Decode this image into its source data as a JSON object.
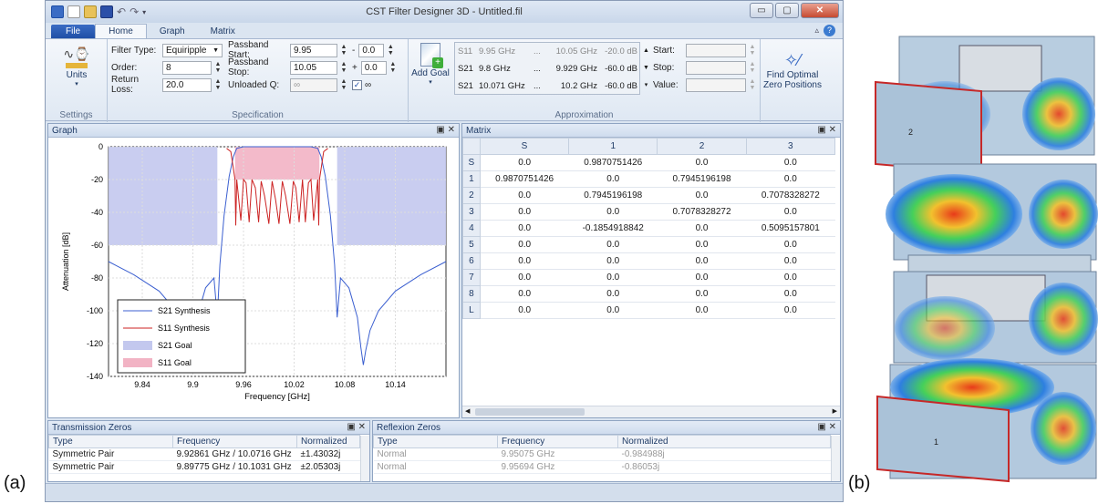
{
  "labels": {
    "a": "(a)",
    "b": "(b)"
  },
  "window": {
    "title": "CST Filter Designer 3D - Untitled.fil",
    "controls": [
      "▭",
      "▢",
      "✕"
    ]
  },
  "ribbon_tabs": {
    "file": "File",
    "home": "Home",
    "graph": "Graph",
    "matrix": "Matrix"
  },
  "settings": {
    "units_label": "Units",
    "group_label": "Settings"
  },
  "spec": {
    "group_label": "Specification",
    "filter_type_label": "Filter Type:",
    "filter_type_value": "Equiripple",
    "order_label": "Order:",
    "order_value": "8",
    "return_loss_label": "Return Loss:",
    "return_loss_value": "20.0",
    "pass_start_label": "Passband Start:",
    "pass_start_value": "9.95",
    "pass_start_offset": "0.0",
    "pass_stop_label": "Passband Stop:",
    "pass_stop_value": "10.05",
    "pass_stop_offset": "0.0",
    "unloaded_q_label": "Unloaded Q:",
    "unloaded_q_value": "∞",
    "infinity_check": "∞"
  },
  "approx": {
    "group_label": "Approximation",
    "add_goal_label": "Add Goal",
    "goals": [
      {
        "param": "S11",
        "f1": "9.95 GHz",
        "sep": "...",
        "f2": "10.05 GHz",
        "level": "-20.0 dB"
      },
      {
        "param": "S21",
        "f1": "9.8 GHz",
        "sep": "...",
        "f2": "9.929 GHz",
        "level": "-60.0 dB"
      },
      {
        "param": "S21",
        "f1": "10.071 GHz",
        "sep": "...",
        "f2": "10.2 GHz",
        "level": "-60.0 dB"
      }
    ],
    "start_label": "Start:",
    "stop_label": "Stop:",
    "value_label": "Value:",
    "find_zero_label": "Find Optimal Zero Positions"
  },
  "graph_panel": {
    "title": "Graph"
  },
  "matrix_panel": {
    "title": "Matrix",
    "columns": [
      "",
      "S",
      "1",
      "2",
      "3"
    ],
    "rows": [
      [
        "S",
        "0.0",
        "0.9870751426",
        "0.0",
        "0.0"
      ],
      [
        "1",
        "0.9870751426",
        "0.0",
        "0.7945196198",
        "0.0"
      ],
      [
        "2",
        "0.0",
        "0.7945196198",
        "0.0",
        "0.7078328272"
      ],
      [
        "3",
        "0.0",
        "0.0",
        "0.7078328272",
        "0.0"
      ],
      [
        "4",
        "0.0",
        "-0.1854918842",
        "0.0",
        "0.5095157801"
      ],
      [
        "5",
        "0.0",
        "0.0",
        "0.0",
        "0.0"
      ],
      [
        "6",
        "0.0",
        "0.0",
        "0.0",
        "0.0"
      ],
      [
        "7",
        "0.0",
        "0.0",
        "0.0",
        "0.0"
      ],
      [
        "8",
        "0.0",
        "0.0",
        "0.0",
        "0.0"
      ],
      [
        "L",
        "0.0",
        "0.0",
        "0.0",
        "0.0"
      ]
    ]
  },
  "tz_panel": {
    "title": "Transmission Zeros",
    "columns": [
      "Type",
      "Frequency",
      "Normalized"
    ],
    "rows": [
      [
        "Symmetric Pair",
        "9.92861 GHz / 10.0716 GHz",
        "±1.43032j"
      ],
      [
        "Symmetric Pair",
        "9.89775 GHz / 10.1031 GHz",
        "±2.05303j"
      ]
    ]
  },
  "rz_panel": {
    "title": "Reflexion Zeros",
    "columns": [
      "Type",
      "Frequency",
      "Normalized"
    ],
    "rows": [
      [
        "Normal",
        "9.95075 GHz",
        "-0.984988j"
      ],
      [
        "Normal",
        "9.95694 GHz",
        "-0.86053j"
      ]
    ]
  },
  "chart_data": {
    "type": "line",
    "xlabel": "Frequency [GHz]",
    "ylabel": "Attenuation [dB]",
    "xlim": [
      9.8,
      10.2
    ],
    "ylim": [
      -140,
      0
    ],
    "xticks": [
      9.84,
      9.9,
      9.96,
      10.02,
      10.08,
      10.14
    ],
    "yticks": [
      0,
      -20,
      -40,
      -60,
      -80,
      -100,
      -120,
      -140
    ],
    "grid": true,
    "legend_position": "bottom-left",
    "goal_regions": [
      {
        "name": "S21 Goal",
        "x": [
          9.8,
          9.929
        ],
        "y": [
          -60,
          0
        ],
        "color": "#c3c8ee"
      },
      {
        "name": "S21 Goal",
        "x": [
          10.071,
          10.2
        ],
        "y": [
          -60,
          0
        ],
        "color": "#c3c8ee"
      },
      {
        "name": "S11 Goal",
        "x": [
          9.95,
          10.05
        ],
        "y": [
          -20,
          0
        ],
        "color": "#f2b3c4"
      }
    ],
    "series": [
      {
        "name": "S21 Synthesis",
        "color": "#3b5fd0",
        "x": [
          9.8,
          9.83,
          9.86,
          9.88,
          9.89,
          9.895,
          9.898,
          9.901,
          9.905,
          9.915,
          9.925,
          9.929,
          9.932,
          9.937,
          9.943,
          9.948,
          9.952,
          9.96,
          10.0,
          10.04,
          10.048,
          10.052,
          10.057,
          10.063,
          10.068,
          10.071,
          10.075,
          10.085,
          10.095,
          10.099,
          10.102,
          10.105,
          10.11,
          10.12,
          10.14,
          10.17,
          10.2
        ],
        "y": [
          -70,
          -78,
          -88,
          -100,
          -112,
          -124,
          -133,
          -122,
          -104,
          -86,
          -80,
          -104,
          -72,
          -42,
          -18,
          -6,
          -1,
          0,
          0,
          0,
          -1,
          -6,
          -18,
          -42,
          -72,
          -104,
          -80,
          -86,
          -104,
          -122,
          -133,
          -124,
          -112,
          -100,
          -88,
          -78,
          -70
        ]
      },
      {
        "name": "S11 Synthesis",
        "color": "#cc2222",
        "x": [
          9.94,
          9.945,
          9.95,
          9.9508,
          9.952,
          9.9569,
          9.96,
          9.963,
          9.9667,
          9.97,
          9.974,
          9.978,
          9.981,
          9.985,
          9.99,
          9.994,
          9.998,
          10.002,
          10.006,
          10.01,
          10.015,
          10.019,
          10.022,
          10.026,
          10.03,
          10.0333,
          10.037,
          10.04,
          10.0431,
          10.048,
          10.0492,
          10.05,
          10.055,
          10.06
        ],
        "y": [
          -1,
          -3,
          -20,
          -48,
          -20,
          -45,
          -20,
          -22,
          -46,
          -20,
          -25,
          -46,
          -21,
          -30,
          -47,
          -21,
          -32,
          -47,
          -21,
          -30,
          -47,
          -21,
          -25,
          -46,
          -20,
          -46,
          -22,
          -20,
          -45,
          -20,
          -48,
          -20,
          -3,
          -1
        ]
      }
    ],
    "legend": [
      "S21 Synthesis",
      "S11 Synthesis",
      "S21 Goal",
      "S11 Goal"
    ]
  }
}
